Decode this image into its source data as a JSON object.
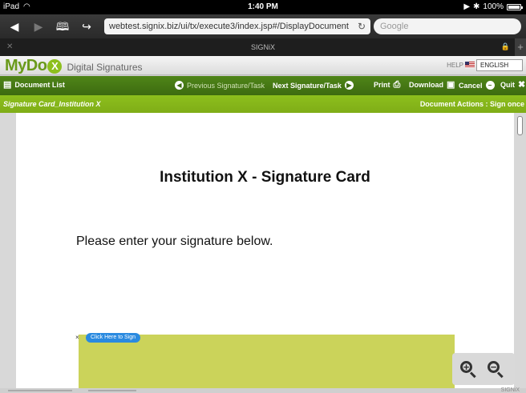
{
  "status_bar": {
    "device": "iPad",
    "time": "1:40 PM",
    "battery": "100%"
  },
  "browser": {
    "url": "webtest.signix.biz/ui/tx/execute3/index.jsp#/DisplayDocument",
    "search_placeholder": "Google",
    "tab_title": "SIGNiX"
  },
  "app": {
    "logo_text": "MyDo",
    "logo_badge": "X",
    "subtitle": "Digital Signatures",
    "help": "HELP",
    "language": "ENGLISH"
  },
  "toolbar": {
    "document_list": "Document List",
    "previous": "Previous Signature/Task",
    "next": "Next Signature/Task",
    "print": "Print",
    "download": "Download",
    "cancel": "Cancel",
    "quit": "Quit"
  },
  "breadcrumb": {
    "document": "Signature Card_Institution X",
    "actions": "Document Actions : Sign once"
  },
  "document": {
    "title": "Institution X - Signature Card",
    "instruction": "Please enter your signature below.",
    "sign_marker": "×",
    "sign_button": "Click Here to Sign"
  },
  "footer": {
    "brand": "SIGNiX"
  },
  "colors": {
    "header_green": "#3d6b10",
    "crumb_green": "#8dbf1d",
    "signature_box": "#cbd35a",
    "sign_button": "#2a8ae0"
  }
}
